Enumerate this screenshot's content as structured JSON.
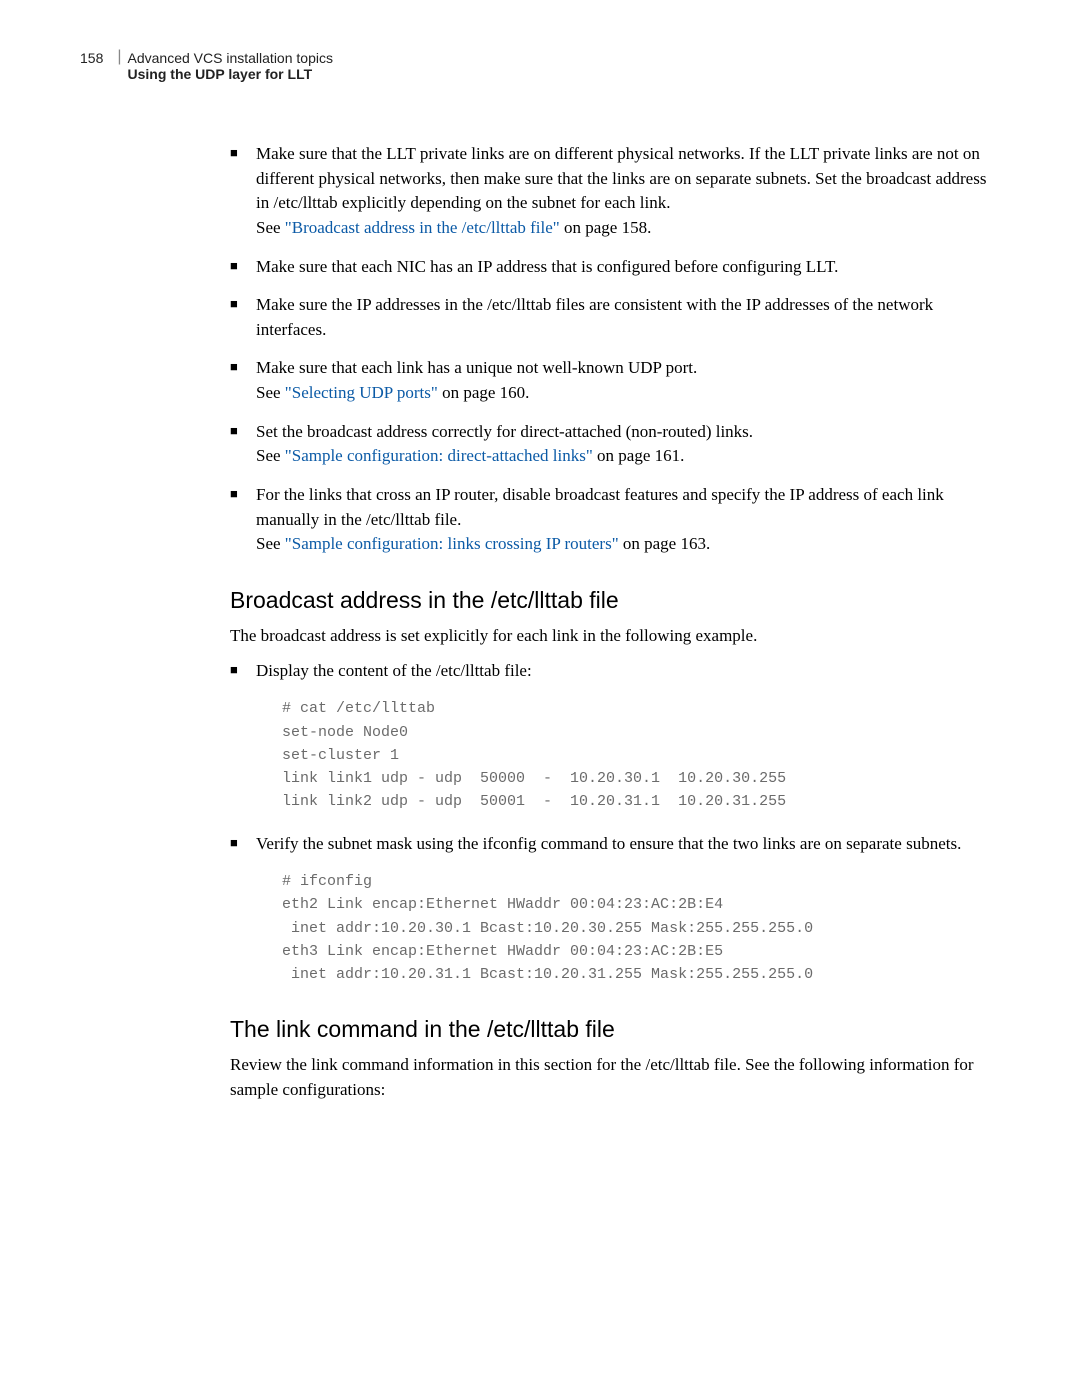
{
  "header": {
    "pageNumber": "158",
    "title": "Advanced VCS installation topics",
    "subtitle": "Using the UDP layer for LLT"
  },
  "bulletsTop": [
    {
      "text": "Make sure that the LLT private links are on different physical networks.\nIf the LLT private links are not on different physical networks, then make sure that the links are on separate subnets. Set the broadcast address in /etc/llttab explicitly depending on the subnet for each link.",
      "seePrefix": "See ",
      "seeLink": "\"Broadcast address in the /etc/llttab file\"",
      "seeSuffix": " on page 158."
    },
    {
      "text": "Make sure that each NIC has an IP address that is configured before configuring LLT."
    },
    {
      "text": "Make sure the IP addresses in the /etc/llttab files are consistent with the IP addresses of the network interfaces."
    },
    {
      "text": "Make sure that each link has a unique not well-known UDP port.",
      "seePrefix": "See ",
      "seeLink": "\"Selecting UDP ports\"",
      "seeSuffix": " on page 160."
    },
    {
      "text": "Set the broadcast address correctly for direct-attached (non-routed) links.",
      "seePrefix": "See ",
      "seeLink": "\"Sample configuration: direct-attached links\"",
      "seeSuffix": " on page 161."
    },
    {
      "text": "For the links that cross an IP router, disable broadcast features and specify the IP address of each link manually in the /etc/llttab file.",
      "seePrefix": "See ",
      "seeLink": "\"Sample configuration: links crossing IP routers\"",
      "seeSuffix": " on page 163."
    }
  ],
  "section1": {
    "heading": "Broadcast address in the /etc/llttab file",
    "intro": "The broadcast address is set explicitly for each link in the following example.",
    "bullet1": "Display the content of the /etc/llttab file:",
    "code1": "# cat /etc/llttab\nset-node Node0\nset-cluster 1\nlink link1 udp - udp  50000  -  10.20.30.1  10.20.30.255\nlink link2 udp - udp  50001  -  10.20.31.1  10.20.31.255",
    "bullet2": "Verify the subnet mask using the ifconfig command to ensure that the two links are on separate subnets.",
    "code2": "# ifconfig\neth2 Link encap:Ethernet HWaddr 00:04:23:AC:2B:E4\n inet addr:10.20.30.1 Bcast:10.20.30.255 Mask:255.255.255.0\neth3 Link encap:Ethernet HWaddr 00:04:23:AC:2B:E5\n inet addr:10.20.31.1 Bcast:10.20.31.255 Mask:255.255.255.0"
  },
  "section2": {
    "heading": "The link command in the /etc/llttab file",
    "intro": "Review the link command information in this section for the /etc/llttab file. See the following information for sample configurations:"
  }
}
